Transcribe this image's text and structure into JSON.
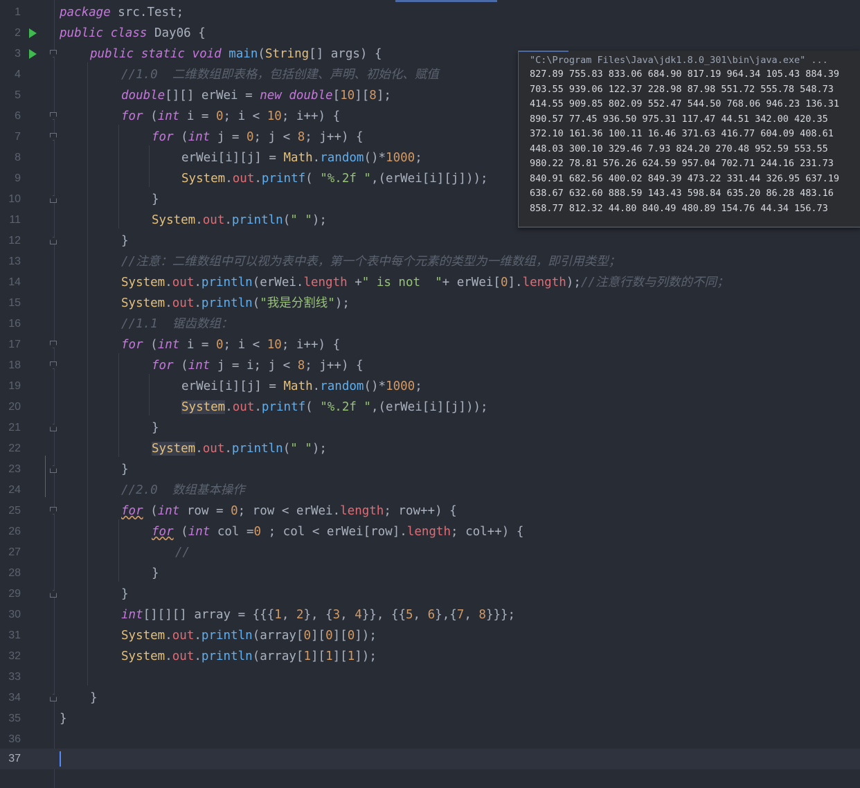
{
  "editor": {
    "line_numbers": [
      "1",
      "2",
      "3",
      "4",
      "5",
      "6",
      "7",
      "8",
      "9",
      "10",
      "11",
      "12",
      "13",
      "14",
      "15",
      "16",
      "17",
      "18",
      "19",
      "20",
      "21",
      "22",
      "23",
      "24",
      "25",
      "26",
      "27",
      "28",
      "29",
      "30",
      "31",
      "32",
      "33",
      "34",
      "35",
      "36",
      "37"
    ],
    "current_line": "37",
    "code": {
      "l1": {
        "a": "package",
        "b": " src.Test;"
      },
      "l2": {
        "a": "public",
        "b": " ",
        "c": "class",
        "d": " Day06 {"
      },
      "l3": {
        "a": "public",
        "b": "static",
        "c": "void",
        "d": "main",
        "e": "String",
        "f": "[] args) {"
      },
      "l4": {
        "a": "//1.0  二维数组即表格，包括创建、声明、初始化、赋值"
      },
      "l5": {
        "a": "double",
        "b": "[][] erWei = ",
        "c": "new",
        "d": "double",
        "e": "[",
        "f": "10",
        "g": "][",
        "h": "8",
        "i": "];"
      },
      "l6": {
        "a": "for",
        "b": " (",
        "c": "int",
        "d": " i = ",
        "e": "0",
        "f": "; i < ",
        "g": "10",
        "h": "; i++) {"
      },
      "l7": {
        "a": "for",
        "b": " (",
        "c": "int",
        "d": " j = ",
        "e": "0",
        "f": "; j < ",
        "g": "8",
        "h": "; j++) {"
      },
      "l8": {
        "a": "erWei[i][j] = ",
        "b": "Math",
        "c": ".",
        "d": "random",
        "e": "()*",
        "f": "1000",
        "g": ";"
      },
      "l9": {
        "a": "System",
        "b": ".",
        "c": "out",
        "d": ".",
        "e": "printf",
        "f": "( ",
        "g": "\"%.2f \"",
        "h": ",(erWei[i][j]));"
      },
      "l10": {
        "a": "}"
      },
      "l11": {
        "a": "System",
        "b": ".",
        "c": "out",
        "d": ".",
        "e": "println",
        "f": "(",
        "g": "\" \"",
        "h": ");"
      },
      "l12": {
        "a": "}"
      },
      "l13": {
        "a": "//注意：二维数组中可以视为表中表，第一个表中每个元素的类型为一维数组，即引用类型；"
      },
      "l14": {
        "a": "System",
        "b": ".",
        "c": "out",
        "d": ".",
        "e": "println",
        "f": "(erWei.",
        "g": "length",
        "h": " +",
        "i": "\" is not  \"",
        "j": "+ erWei[",
        "k": "0",
        "l": "].",
        "m": "length",
        "n": ");",
        "o": "//注意行数与列数的不同；"
      },
      "l15": {
        "a": "System",
        "b": ".",
        "c": "out",
        "d": ".",
        "e": "println",
        "f": "(",
        "g": "\"我是分割线\"",
        "h": ");"
      },
      "l16": {
        "a": "//1.1  锯齿数组："
      },
      "l17": {
        "a": "for",
        "b": " (",
        "c": "int",
        "d": " i = ",
        "e": "0",
        "f": "; i < ",
        "g": "10",
        "h": "; i++) {"
      },
      "l18": {
        "a": "for",
        "b": " (",
        "c": "int",
        "d": " j = i; j < ",
        "e": "8",
        "f": "; j++) {"
      },
      "l19": {
        "a": "erWei[i][j] = ",
        "b": "Math",
        "c": ".",
        "d": "random",
        "e": "()*",
        "f": "1000",
        "g": ";"
      },
      "l20": {
        "a": "System",
        "b": ".",
        "c": "out",
        "d": ".",
        "e": "printf",
        "f": "( ",
        "g": "\"%.2f \"",
        "h": ",(erWei[i][j]));"
      },
      "l21": {
        "a": "}"
      },
      "l22": {
        "a": "System",
        "b": ".",
        "c": "out",
        "d": ".",
        "e": "println",
        "f": "(",
        "g": "\" \"",
        "h": ");"
      },
      "l23": {
        "a": "}"
      },
      "l24": {
        "a": "//2.0  数组基本操作"
      },
      "l25": {
        "a": "for",
        "b": " (",
        "c": "int",
        "d": " row = ",
        "e": "0",
        "f": "; row < erWei.",
        "g": "length",
        "h": "; row++) {"
      },
      "l26": {
        "a": "for",
        "b": " (",
        "c": "int",
        "d": " col =",
        "e": "0",
        "f": " ; col < erWei[row].",
        "g": "length",
        "h": "; col++) {"
      },
      "l27": {
        "a": "//"
      },
      "l28": {
        "a": "}"
      },
      "l29": {
        "a": "}"
      },
      "l30": {
        "a": "int",
        "b": "[][][] array = {{{",
        "c": "1",
        "d": ", ",
        "e": "2",
        "f": "}, {",
        "g": "3",
        "h": ", ",
        "i": "4",
        "j": "}}, {{",
        "k": "5",
        "l": ", ",
        "m": "6",
        "n": "},{",
        "o": "7",
        "p": ", ",
        "q": "8",
        "r": "}}};"
      },
      "l31": {
        "a": "System",
        "b": ".",
        "c": "out",
        "d": ".",
        "e": "println",
        "f": "(array[",
        "g": "0",
        "h": "][",
        "i": "0",
        "j": "][",
        "k": "0",
        "l": "]);"
      },
      "l32": {
        "a": "System",
        "b": ".",
        "c": "out",
        "d": ".",
        "e": "println",
        "f": "(array[",
        "g": "1",
        "h": "][",
        "i": "1",
        "j": "][",
        "k": "1",
        "l": "]);"
      },
      "l34": {
        "a": "}"
      },
      "l35": {
        "a": "}"
      }
    }
  },
  "console": {
    "command": "\"C:\\Program Files\\Java\\jdk1.8.0_301\\bin\\java.exe\" ...",
    "output": [
      "827.89 755.83 833.06 684.90 817.19 964.34 105.43 884.39",
      "703.55 939.06 122.37 228.98 87.98 551.72 555.78 548.73",
      "414.55 909.85 802.09 552.47 544.50 768.06 946.23 136.31",
      "890.57 77.45 936.50 975.31 117.47 44.51 342.00 420.35",
      "372.10 161.36 100.11 16.46 371.63 416.77 604.09 408.61",
      "448.03 300.10 329.46 7.93 824.20 270.48 952.59 553.55",
      "980.22 78.81 576.26 624.59 957.04 702.71 244.16 231.73",
      "840.91 682.56 400.02 849.39 473.22 331.44 326.95 637.19",
      "638.67 632.60 888.59 143.43 598.84 635.20 86.28 483.16",
      "858.77 812.32 44.80 840.49 480.89 154.76 44.34 156.73"
    ]
  }
}
